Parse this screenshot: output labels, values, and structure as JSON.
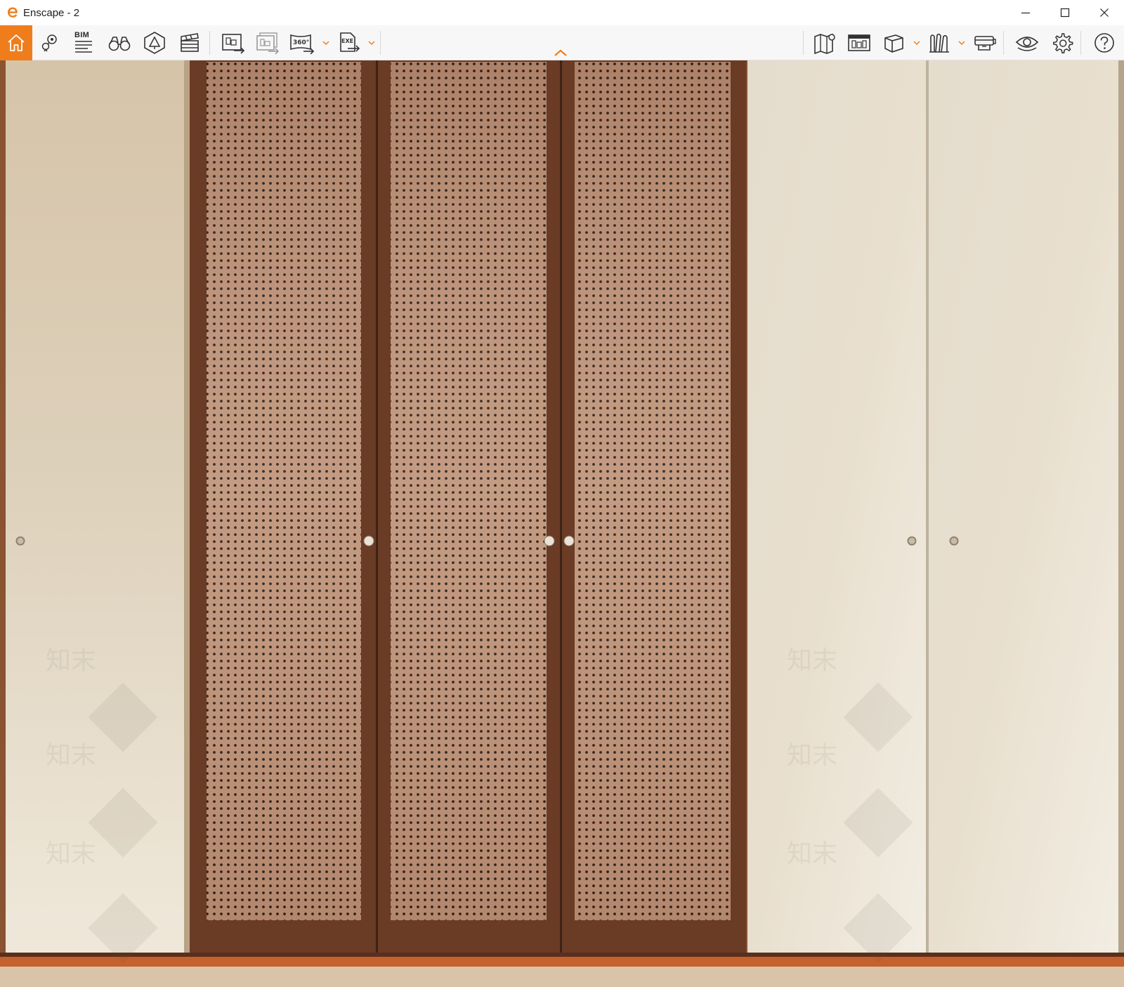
{
  "window": {
    "title": "Enscape - 2",
    "accent_color": "#f07d1c",
    "controls": {
      "minimize_icon": "minimize-icon",
      "maximize_icon": "maximize-icon",
      "close_icon": "close-icon"
    }
  },
  "toolbar": {
    "left_items": [
      {
        "icon": "home-icon",
        "active": true
      },
      {
        "icon": "location-pin-icon"
      },
      {
        "icon": "bim-list-icon",
        "label": "BIM"
      },
      {
        "icon": "binoculars-icon"
      },
      {
        "icon": "asset-library-icon"
      },
      {
        "icon": "clapperboard-icon"
      },
      {
        "icon": "screenshot-export-icon"
      },
      {
        "icon": "batch-export-icon"
      },
      {
        "icon": "panorama-360-export-icon",
        "label": "360°",
        "dropdown": true
      },
      {
        "icon": "standalone-exe-export-icon",
        "label": "EXE",
        "dropdown": true
      }
    ],
    "right_items": [
      {
        "icon": "map-icon"
      },
      {
        "icon": "upload-view-icon"
      },
      {
        "icon": "cube-icon",
        "dropdown": true
      },
      {
        "icon": "library-books-icon",
        "dropdown": true
      },
      {
        "icon": "vr-headset-icon"
      },
      {
        "icon": "eye-icon"
      },
      {
        "icon": "settings-gear-icon"
      },
      {
        "icon": "help-icon"
      }
    ],
    "collapse_icon": "chevron-up-icon"
  },
  "scene": {
    "description_colors": {
      "wall_warm": "#c79a70",
      "door_cream": "#ece4d4",
      "frame_dark_wood": "#6b3a22",
      "perforated_panel": "#b98c6c",
      "floor_orange": "#c4612c"
    },
    "watermark_text": "知末"
  }
}
